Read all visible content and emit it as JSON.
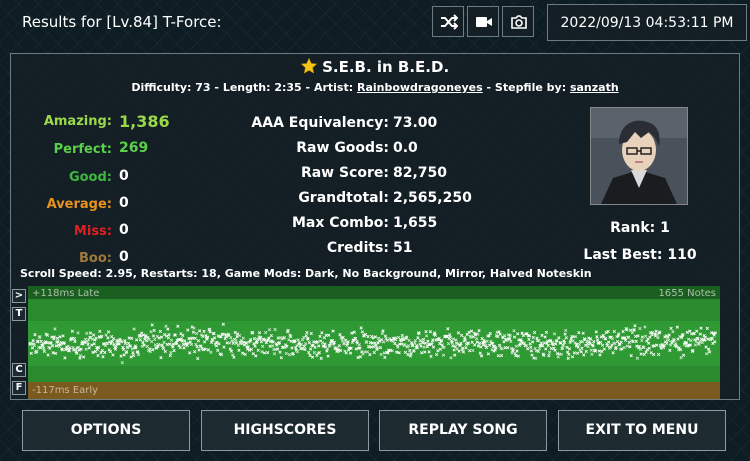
{
  "header": {
    "title": "Results for [Lv.84] T-Force:",
    "date": "2022/09/13 04:53:11 PM",
    "icons": [
      "shuffle-icon",
      "video-camera-icon",
      "camera-icon"
    ]
  },
  "song": {
    "title": "S.E.B. in B.E.D.",
    "difficulty_label": "Difficulty:",
    "difficulty": "73",
    "length_label": "Length:",
    "length": "2:35",
    "artist_label": "Artist:",
    "artist": "Rainbowdragoneyes",
    "stepfile_label": "Stepfile by:",
    "stepfile": "sanzath"
  },
  "judgements": [
    {
      "label": "Amazing:",
      "value": "1,386",
      "color": "#9cd94a"
    },
    {
      "label": "Perfect:",
      "value": "269",
      "color": "#5ad14a"
    },
    {
      "label": "Good:",
      "value": "0",
      "color": "#3fb83f"
    },
    {
      "label": "Average:",
      "value": "0",
      "color": "#e8921f"
    },
    {
      "label": "Miss:",
      "value": "0",
      "color": "#e02020"
    },
    {
      "label": "Boo:",
      "value": "0",
      "color": "#a07a3a"
    }
  ],
  "stats": [
    {
      "label": "AAA Equivalency:",
      "value": "73.00"
    },
    {
      "label": "Raw Goods:",
      "value": "0.0"
    },
    {
      "label": "Raw Score:",
      "value": "82,750"
    },
    {
      "label": "Grandtotal:",
      "value": "2,565,250"
    },
    {
      "label": "Max Combo:",
      "value": "1,655"
    },
    {
      "label": "Credits:",
      "value": "51"
    }
  ],
  "player": {
    "rank_label": "Rank:",
    "rank": "1",
    "last_best_label": "Last Best:",
    "last_best": "110"
  },
  "mods_line": "Scroll Speed: 2.95, Restarts: 18, Game Mods: Dark, No Background, Mirror, Halved Noteskin",
  "graph": {
    "late_label": "+118ms Late",
    "early_label": "-117ms Early",
    "notes_label": "1655 Notes",
    "side_buttons": [
      ">",
      "T",
      "C",
      "F"
    ]
  },
  "buttons": {
    "options": "OPTIONS",
    "highscores": "HIGHSCORES",
    "replay": "REPLAY SONG",
    "exit": "EXIT TO MENU"
  }
}
